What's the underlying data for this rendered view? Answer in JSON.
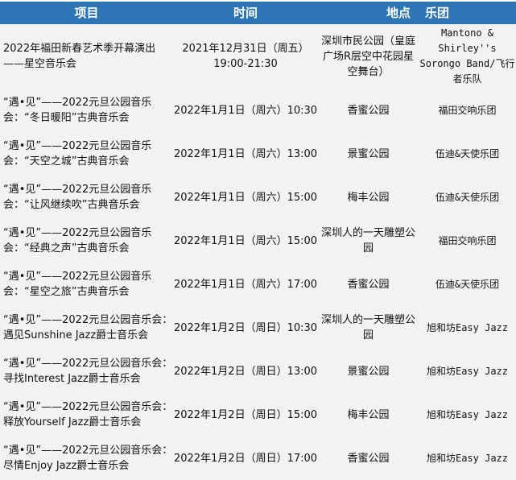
{
  "header": {
    "project": "项目",
    "time": "时间",
    "venue": "地点",
    "band": "乐团"
  },
  "colors": {
    "header_bg": "#2e75b6",
    "body_bg": "#f2f2f2"
  },
  "rows": [
    {
      "project": "2022年福田新春艺术季开幕演出——星空音乐会",
      "time": "2021年12月31日（周五）19:00-21:30",
      "venue": "深圳市民公园（皇庭广场R层空中花园星空舞台）",
      "band": "Mantono & Shirley''s Sorongo Band/飞行者乐队"
    },
    {
      "project": "“遇•见”——2022元旦公园音乐会：“冬日暖阳”古典音乐会",
      "time": "2022年1月1日（周六）10:30",
      "venue": "香蜜公园",
      "band": "福田交响乐团"
    },
    {
      "project": "“遇•见”——2022元旦公园音乐会：“天空之城”古典音乐会",
      "time": "2022年1月1日（周六）13:00",
      "venue": "景蜜公园",
      "band": "伍迪&天使乐团"
    },
    {
      "project": "“遇•见”——2022元旦公园音乐会：“让风继续吹”古典音乐会",
      "time": "2022年1月1日（周六）15:00",
      "venue": "梅丰公园",
      "band": "伍迪&天使乐团"
    },
    {
      "project": "“遇•见”——2022元旦公园音乐会：“经典之声”古典音乐会",
      "time": "2022年1月1日（周六）15:00",
      "venue": "深圳人的一天雕塑公园",
      "band": "福田交响乐团"
    },
    {
      "project": "“遇•见”——2022元旦公园音乐会：“星空之旅”古典音乐会",
      "time": "2022年1月1日（周六）17:00",
      "venue": "香蜜公园",
      "band": "伍迪&天使乐团"
    },
    {
      "project": "“遇•见”——2022元旦公园音乐会：遇见Sunshine Jazz爵士音乐会",
      "time": "2022年1月2日（周日）10:30",
      "venue": "深圳人的一天雕塑公园",
      "band": "旭和坊Easy Jazz"
    },
    {
      "project": "“遇•见”——2022元旦公园音乐会：寻找Interest Jazz爵士音乐会",
      "time": "2022年1月2日（周日）13:00",
      "venue": "景蜜公园",
      "band": "旭和坊Easy Jazz"
    },
    {
      "project": "“遇•见”——2022元旦公园音乐会：释放Yourself Jazz爵士音乐会",
      "time": "2022年1月2日（周日）15:00",
      "venue": "梅丰公园",
      "band": "旭和坊Easy Jazz"
    },
    {
      "project": "“遇•见”——2022元旦公园音乐会：尽情Enjoy Jazz爵士音乐会",
      "time": "2022年1月2日（周日）17:00",
      "venue": "香蜜公园",
      "band": "旭和坊Easy Jazz"
    }
  ]
}
